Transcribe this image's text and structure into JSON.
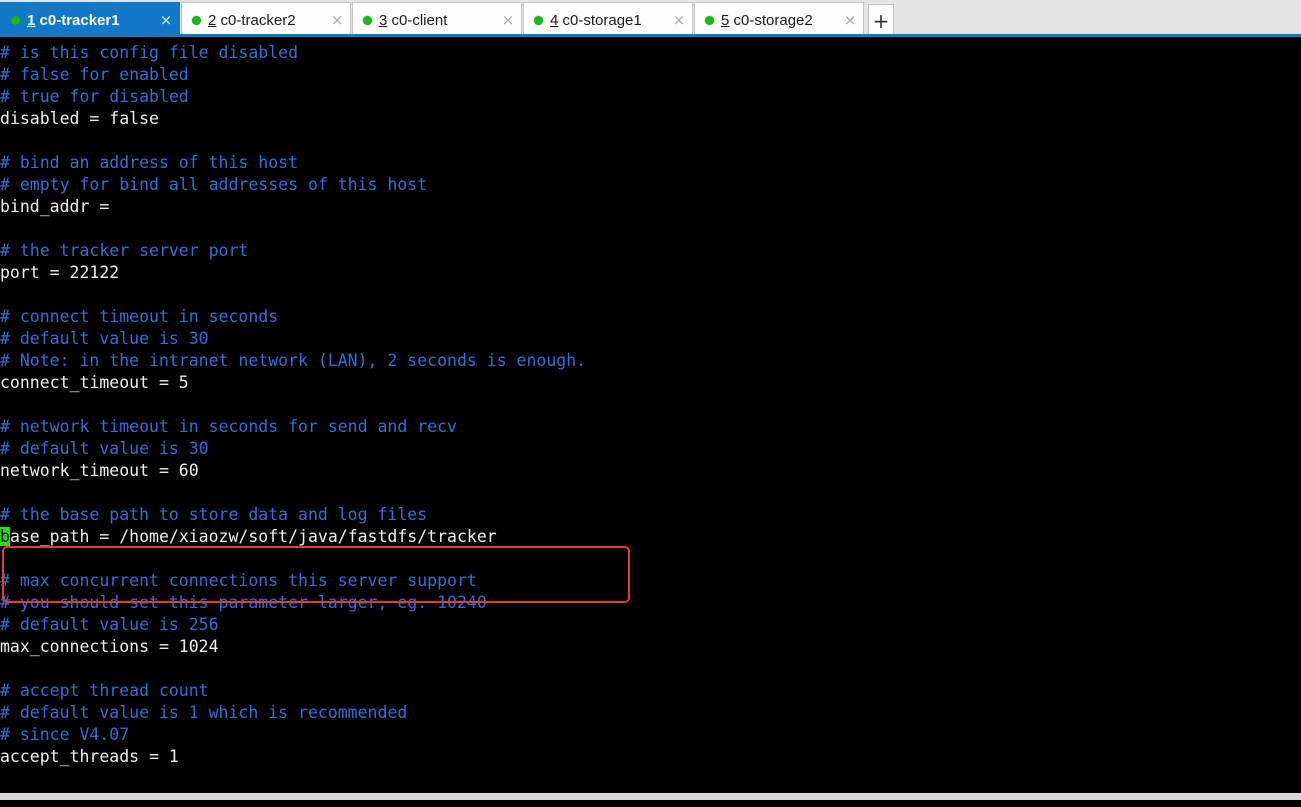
{
  "tabbar": {
    "tabs": [
      {
        "num": "1",
        "name": "c0-tracker1",
        "active": true,
        "status": "green",
        "close": "×"
      },
      {
        "num": "2",
        "name": "c0-tracker2",
        "active": false,
        "status": "green",
        "close": "×"
      },
      {
        "num": "3",
        "name": "c0-client",
        "active": false,
        "status": "green",
        "close": "×"
      },
      {
        "num": "4",
        "name": "c0-storage1",
        "active": false,
        "status": "green",
        "close": "×"
      },
      {
        "num": "5",
        "name": "c0-storage2",
        "active": false,
        "status": "green",
        "close": "×"
      }
    ],
    "new_tab_label": "+"
  },
  "terminal": {
    "cursor_char": "b",
    "cursor_line_index": 25,
    "colors": {
      "background": "#000000",
      "comment": "#2f6fd8",
      "code": "#f0f0f0",
      "cursor": "#19e219",
      "annotation": "#e8373a",
      "tab_active": "#1278c8",
      "tab_underline": "#0a7ec0"
    },
    "lines": [
      {
        "t": "# is this config file disabled",
        "k": "cmt"
      },
      {
        "t": "# false for enabled",
        "k": "cmt"
      },
      {
        "t": "# true for disabled",
        "k": "cmt"
      },
      {
        "t": "disabled = false",
        "k": "code"
      },
      {
        "t": "",
        "k": "code"
      },
      {
        "t": "# bind an address of this host",
        "k": "cmt"
      },
      {
        "t": "# empty for bind all addresses of this host",
        "k": "cmt"
      },
      {
        "t": "bind_addr =",
        "k": "code"
      },
      {
        "t": "",
        "k": "code"
      },
      {
        "t": "# the tracker server port",
        "k": "cmt"
      },
      {
        "t": "port = 22122",
        "k": "code"
      },
      {
        "t": "",
        "k": "code"
      },
      {
        "t": "# connect timeout in seconds",
        "k": "cmt"
      },
      {
        "t": "# default value is 30",
        "k": "cmt"
      },
      {
        "t": "# Note: in the intranet network (LAN), 2 seconds is enough.",
        "k": "cmt"
      },
      {
        "t": "connect_timeout = 5",
        "k": "code"
      },
      {
        "t": "",
        "k": "code"
      },
      {
        "t": "# network timeout in seconds for send and recv",
        "k": "cmt"
      },
      {
        "t": "# default value is 30",
        "k": "cmt"
      },
      {
        "t": "network_timeout = 60",
        "k": "code"
      },
      {
        "t": "",
        "k": "code"
      },
      {
        "t": "# the base path to store data and log files",
        "k": "cmt"
      },
      {
        "t": "base_path = /home/xiaozw/soft/java/fastdfs/tracker",
        "k": "code",
        "cursor": true
      },
      {
        "t": "",
        "k": "code"
      },
      {
        "t": "# max concurrent connections this server support",
        "k": "cmt"
      },
      {
        "t": "# you should set this parameter larger, eg. 10240",
        "k": "cmt"
      },
      {
        "t": "# default value is 256",
        "k": "cmt"
      },
      {
        "t": "max_connections = 1024",
        "k": "code"
      },
      {
        "t": "",
        "k": "code"
      },
      {
        "t": "# accept thread count",
        "k": "cmt"
      },
      {
        "t": "# default value is 1 which is recommended",
        "k": "cmt"
      },
      {
        "t": "# since V4.07",
        "k": "cmt"
      },
      {
        "t": "accept_threads = 1",
        "k": "code"
      }
    ]
  }
}
